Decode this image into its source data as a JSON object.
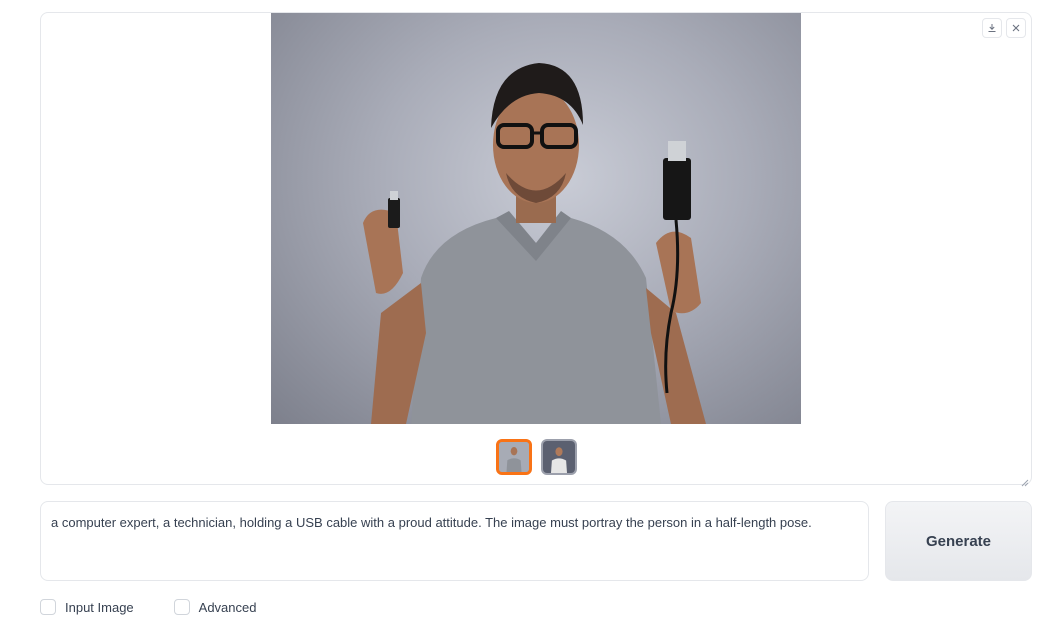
{
  "gallery": {
    "download_icon": "download-icon",
    "close_icon": "close-icon",
    "main_image_alt": "",
    "thumbnails": [
      {
        "selected": true
      },
      {
        "selected": false
      }
    ]
  },
  "prompt": {
    "value": "a computer expert, a technician, holding a USB cable with a proud attitude. The image must portray the person in a half-length pose."
  },
  "generate": {
    "label": "Generate"
  },
  "options": {
    "input_image_label": "Input Image",
    "advanced_label": "Advanced"
  },
  "colors": {
    "accent": "#f97316",
    "border": "#e5e7eb",
    "button_bg": "#e5e7eb",
    "text": "#374151"
  }
}
